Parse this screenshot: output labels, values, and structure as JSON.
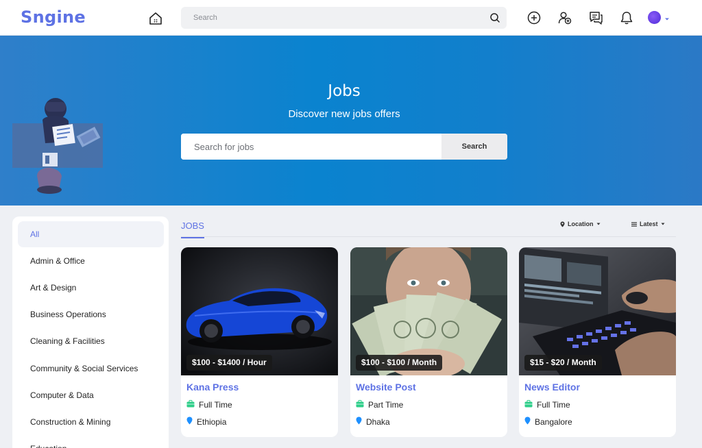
{
  "app": {
    "logo": "Sngine"
  },
  "topbar": {
    "search_placeholder": "Search",
    "icons": [
      "home-icon",
      "search-icon",
      "add-icon",
      "add-user-icon",
      "messages-icon",
      "bell-icon",
      "avatar",
      "caret-down-icon"
    ]
  },
  "hero": {
    "title": "Jobs",
    "subtitle": "Discover new jobs offers",
    "search_placeholder": "Search for jobs",
    "search_button": "Search"
  },
  "categories": [
    {
      "label": "All",
      "active": true
    },
    {
      "label": "Admin & Office"
    },
    {
      "label": "Art & Design"
    },
    {
      "label": "Business Operations"
    },
    {
      "label": "Cleaning & Facilities"
    },
    {
      "label": "Community & Social Services"
    },
    {
      "label": "Computer & Data"
    },
    {
      "label": "Construction & Mining"
    },
    {
      "label": "Education"
    }
  ],
  "jobs_section": {
    "tab": "JOBS",
    "location_filter": "Location",
    "sort_filter": "Latest"
  },
  "jobs": [
    {
      "price": "$100 - $1400 / Hour",
      "title": "Kana Press",
      "type": "Full Time",
      "location": "Ethiopia",
      "image": "blue-sports-car"
    },
    {
      "price": "$100 - $100 / Month",
      "title": "Website Post",
      "type": "Part Time",
      "location": "Dhaka",
      "image": "person-holding-cash"
    },
    {
      "price": "$15 - $20 / Month",
      "title": "News Editor",
      "type": "Full Time",
      "location": "Bangalore",
      "image": "laptop-video-editing"
    }
  ],
  "colors": {
    "accent": "#5e72e4",
    "hero": "#0a83cf",
    "briefcase": "#2dce89",
    "pin": "#1e90ff"
  }
}
